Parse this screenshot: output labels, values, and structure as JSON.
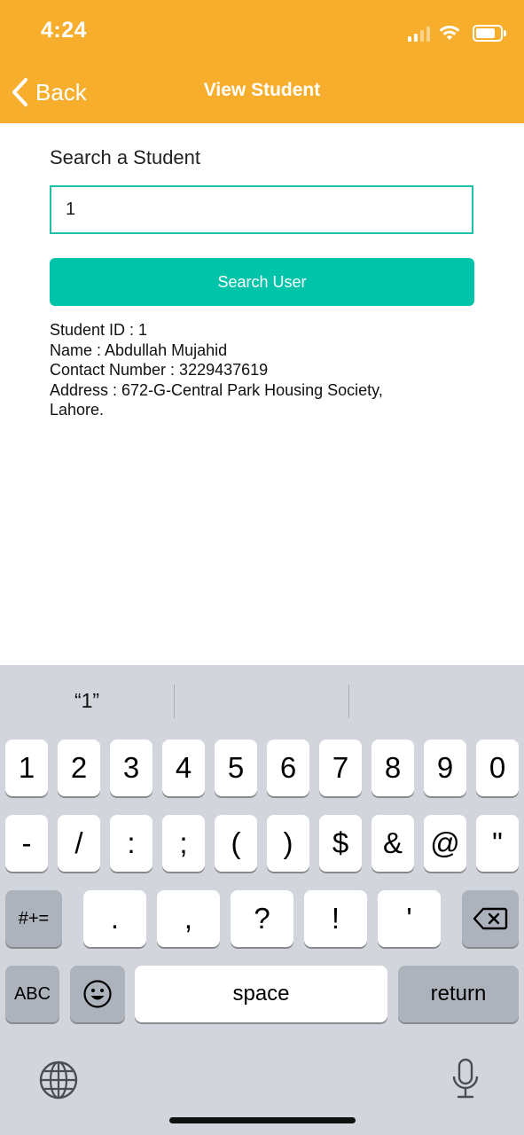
{
  "status_bar": {
    "time": "4:24"
  },
  "header": {
    "back_label": "Back",
    "title": "View Student"
  },
  "search": {
    "label": "Search a Student",
    "input_value": "1",
    "button_label": "Search User"
  },
  "result": {
    "student_id": "Student ID : 1",
    "name": "Name : Abdullah Mujahid",
    "contact": "Contact Number : 3229437619",
    "address_line1": "Address : 672-G-Central Park Housing Society,",
    "address_line2": "Lahore."
  },
  "keyboard": {
    "suggestions": [
      "“1”",
      "",
      ""
    ],
    "row_numbers": [
      "1",
      "2",
      "3",
      "4",
      "5",
      "6",
      "7",
      "8",
      "9",
      "0"
    ],
    "row_symbols": [
      "-",
      "/",
      ":",
      ";",
      "(",
      ")",
      "$",
      "&",
      "@",
      "\""
    ],
    "row_punct": [
      ".",
      ",",
      "?",
      "!",
      "'"
    ],
    "mode_key": "#+=",
    "abc_key": "ABC",
    "space_key": "space",
    "return_key": "return"
  },
  "colors": {
    "header": "#F7AE2D",
    "accent": "#00C4AA"
  },
  "icons": [
    "back-chevron-icon",
    "signal-icon",
    "wifi-icon",
    "battery-icon",
    "backspace-icon",
    "emoji-icon",
    "globe-icon",
    "microphone-icon"
  ]
}
